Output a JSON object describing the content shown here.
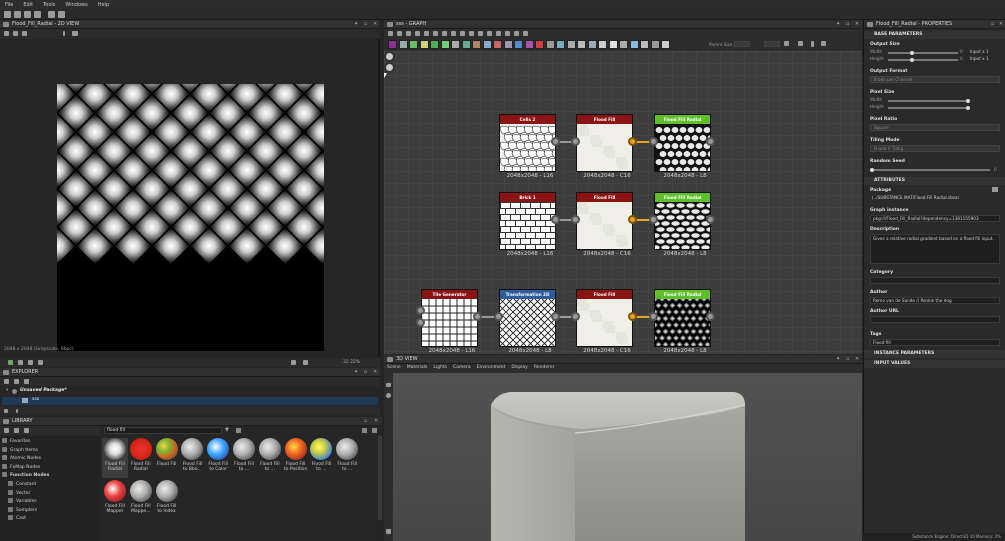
{
  "menu": [
    "File",
    "Edit",
    "Tools",
    "Windows",
    "Help"
  ],
  "view2d": {
    "title": "Flood_Fill_Radial - 2D VIEW",
    "info": "2048 x 2048 (Grayscale, 8bpc)",
    "zoom": "32.22%"
  },
  "graph": {
    "title": "sss - GRAPH",
    "parent_size_label": "Parent Size:",
    "nodes": [
      {
        "title": "Cells 2",
        "color": "#8a1414",
        "label": "2048x2048 - L16",
        "pattern": "cells"
      },
      {
        "title": "Flood Fill",
        "color": "#8a1414",
        "label": "2048x2048 - C16",
        "pattern": "ff"
      },
      {
        "title": "Flood Fill Radial",
        "color": "#5fbf2a",
        "label": "2048x2048 - L8",
        "pattern": "cellsbw"
      },
      {
        "title": "Brick 1",
        "color": "#8a1414",
        "label": "2048x2048 - L16",
        "pattern": "brick"
      },
      {
        "title": "Flood Fill",
        "color": "#8a1414",
        "label": "2048x2048 - C16",
        "pattern": "ff"
      },
      {
        "title": "Flood Fill Radial",
        "color": "#5fbf2a",
        "label": "2048x2048 - L8",
        "pattern": "brickbw"
      },
      {
        "title": "Tile Generator",
        "color": "#8a1414",
        "label": "2048x2048 - L16",
        "pattern": "grid"
      },
      {
        "title": "Transformation 2D",
        "color": "#2d5c9a",
        "label": "2048x2048 - L8",
        "pattern": "diag"
      },
      {
        "title": "Flood Fill",
        "color": "#8a1414",
        "label": "2048x2048 - C16",
        "pattern": "ff"
      },
      {
        "title": "Flood Fill Radial",
        "color": "#5fbf2a",
        "label": "2048x2048 - L8",
        "pattern": "diagbw"
      }
    ]
  },
  "view3d": {
    "title": "3D VIEW",
    "tabs": [
      "Scene",
      "Materials",
      "Lights",
      "Camera",
      "Environment",
      "Display",
      "Renderer"
    ]
  },
  "explorer": {
    "title": "EXPLORER",
    "package": "Unsaved Package*",
    "item": "sss"
  },
  "library": {
    "title": "LIBRARY",
    "search": "flood fill",
    "tree": [
      {
        "label": "Favorites",
        "bold": false
      },
      {
        "label": "Graph Items",
        "bold": false
      },
      {
        "label": "Atomic Nodes",
        "bold": false
      },
      {
        "label": "FxMap Nodes",
        "bold": false
      },
      {
        "label": "Function Nodes",
        "bold": true
      },
      {
        "label": "Constant",
        "bold": false
      },
      {
        "label": "Vector",
        "bold": false
      },
      {
        "label": "Variables",
        "bold": false
      },
      {
        "label": "Samplers",
        "bold": false
      },
      {
        "label": "Cast",
        "bold": false
      }
    ],
    "items": [
      {
        "label": "Flood Fill\nRadial",
        "style": "radial",
        "selected": true
      },
      {
        "label": "Flood Fill\nRadial",
        "style": "logo",
        "selected": false
      },
      {
        "label": "Flood Fill",
        "style": "multi",
        "selected": false
      },
      {
        "label": "Flood Fill\nto Bbo...",
        "style": "gray",
        "selected": false
      },
      {
        "label": "Flood Fill\nto Color",
        "style": "blue",
        "selected": false
      },
      {
        "label": "Flood Fill\nto ...",
        "style": "gray",
        "selected": false
      },
      {
        "label": "Flood Fill\nto ...",
        "style": "gray",
        "selected": false
      },
      {
        "label": "Flood Fill\nto Position",
        "style": "color",
        "selected": false
      },
      {
        "label": "Flood Fill\nto ...",
        "style": "yellowblue",
        "selected": false
      },
      {
        "label": "Flood Fill\nto ...",
        "style": "gray",
        "selected": false
      },
      {
        "label": "Flood Fill\nMapper",
        "style": "red",
        "selected": false
      },
      {
        "label": "Flood Fill\nMappe...",
        "style": "gray",
        "selected": false
      },
      {
        "label": "Flood Fill\nto Index",
        "style": "gray",
        "selected": false
      }
    ]
  },
  "properties": {
    "title": "Flood_Fill_Radial - PROPERTIES",
    "base_section": "BASE PARAMETERS",
    "output_size": "Output Size",
    "width": "Width",
    "height": "Height",
    "w_val": "0",
    "h_val": "0",
    "w_mode": "Input x 1",
    "h_mode": "Input x 1",
    "output_format": "Output Format",
    "output_format_value": "8 bits per Channel",
    "pixel_size": "Pixel Size",
    "pixel_ratio": "Pixel Ratio",
    "pixel_ratio_value": "Square",
    "tiling_mode": "Tiling Mode",
    "tiling_mode_value": "H and V Tiling",
    "random_seed": "Random Seed",
    "seed_value": "0",
    "attributes_section": "ATTRIBUTES",
    "package": "Package",
    "package_value": "(../SUBSTANCE MAT/Flood Fill Radial.sbsar",
    "graph_instance": "Graph instance",
    "graph_instance_value": "pkg:///Flood_Fill_Radial?dependency=1381155903",
    "description": "Description",
    "description_value": "Gives a relative radial gradient based on a flood fill input.",
    "category": "Category",
    "author": "Author",
    "author_value": "Remo van de Sande // Ponkie the dog",
    "author_url": "Author URL",
    "tags": "Tags",
    "tags_value": "Flood fill",
    "instance_section": "INSTANCE PARAMETERS",
    "input_section": "INPUT VALUES"
  },
  "status": "Substance Engine: Direct3D 10  Memory: 2%"
}
